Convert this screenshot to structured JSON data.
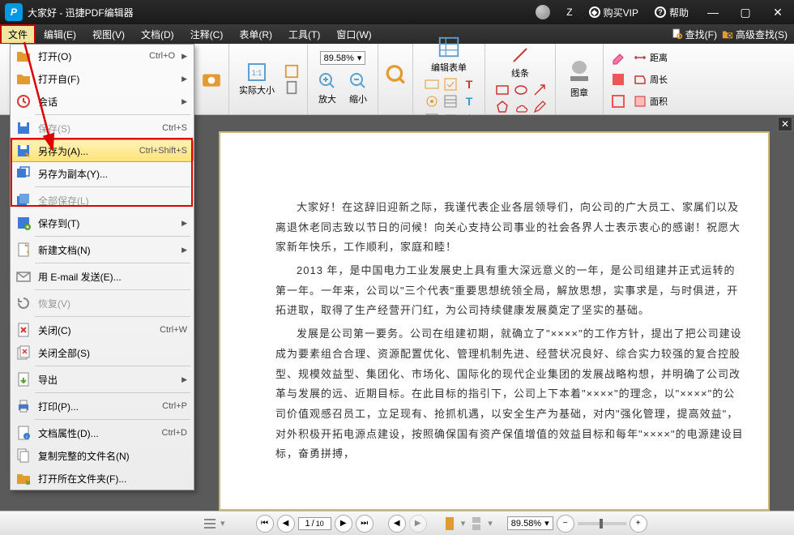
{
  "title": "大家好 - 迅捷PDF编辑器",
  "titlebar": {
    "z": "Z",
    "vip": "购买VIP",
    "help": "帮助"
  },
  "menubar": {
    "items": [
      "文件",
      "编辑(E)",
      "视图(V)",
      "文档(D)",
      "注释(C)",
      "表单(R)",
      "工具(T)",
      "窗口(W)"
    ],
    "find": "查找(F)",
    "advfind": "高级查找(S)"
  },
  "toolbar": {
    "actualsize": "实际大小",
    "zoomin": "放大",
    "zoomout": "缩小",
    "zoom_val": "89.58%",
    "editform": "编辑表单",
    "line": "线条",
    "image": "图章",
    "distance": "距离",
    "perimeter": "周长",
    "area": "面积"
  },
  "dropdown": {
    "items": [
      {
        "label": "打开(O)",
        "shortcut": "Ctrl+O",
        "arrow": true,
        "icon": "folder"
      },
      {
        "label": "打开自(F)",
        "shortcut": "",
        "arrow": true,
        "icon": "folder"
      },
      {
        "label": "会话",
        "shortcut": "",
        "arrow": true,
        "icon": "session"
      },
      {
        "sep": true
      },
      {
        "label": "保存(S)",
        "shortcut": "Ctrl+S",
        "arrow": false,
        "icon": "save",
        "disabled": true
      },
      {
        "label": "另存为(A)...",
        "shortcut": "Ctrl+Shift+S",
        "arrow": false,
        "icon": "saveas",
        "hover": true
      },
      {
        "label": "另存为副本(Y)...",
        "shortcut": "",
        "arrow": false,
        "icon": "savecopy"
      },
      {
        "sep": true
      },
      {
        "label": "全部保存(L)",
        "shortcut": "",
        "arrow": false,
        "icon": "saveall",
        "disabled": true
      },
      {
        "label": "保存到(T)",
        "shortcut": "",
        "arrow": true,
        "icon": "saveto"
      },
      {
        "sep": true
      },
      {
        "label": "新建文档(N)",
        "shortcut": "",
        "arrow": true,
        "icon": "newdoc"
      },
      {
        "sep": true
      },
      {
        "label": "用 E-mail 发送(E)...",
        "shortcut": "",
        "arrow": false,
        "icon": "email"
      },
      {
        "sep": true
      },
      {
        "label": "恢复(V)",
        "shortcut": "",
        "arrow": false,
        "icon": "restore",
        "disabled": true
      },
      {
        "sep": true
      },
      {
        "label": "关闭(C)",
        "shortcut": "Ctrl+W",
        "arrow": false,
        "icon": "close"
      },
      {
        "label": "关闭全部(S)",
        "shortcut": "",
        "arrow": false,
        "icon": "closeall"
      },
      {
        "sep": true
      },
      {
        "label": "导出",
        "shortcut": "",
        "arrow": true,
        "icon": "export"
      },
      {
        "sep": true
      },
      {
        "label": "打印(P)...",
        "shortcut": "Ctrl+P",
        "arrow": false,
        "icon": "print"
      },
      {
        "sep": true
      },
      {
        "label": "文档属性(D)...",
        "shortcut": "Ctrl+D",
        "arrow": false,
        "icon": "props"
      },
      {
        "label": "复制完整的文件名(N)",
        "shortcut": "",
        "arrow": false,
        "icon": "copyname"
      },
      {
        "label": "打开所在文件夹(F)...",
        "shortcut": "",
        "arrow": false,
        "icon": "openfolder"
      }
    ]
  },
  "document": {
    "p1": "大家好！在这辞旧迎新之际，我谨代表企业各层领导们，向公司的广大员工、家属们以及离退休老同志致以节日的问候！向关心支持公司事业的社会各界人士表示衷心的感谢！祝愿大家新年快乐，工作顺利，家庭和睦！",
    "p2": "2013 年，是中国电力工业发展史上具有重大深远意义的一年，是公司组建并正式运转的第一年。一年来，公司以\"三个代表\"重要思想统领全局，解放思想，实事求是，与时俱进，开拓进取，取得了生产经营开门红，为公司持续健康发展奠定了坚实的基础。",
    "p3": "发展是公司第一要务。公司在组建初期，就确立了\"××××\"的工作方针，提出了把公司建设成为要素组合合理、资源配置优化、管理机制先进、经营状况良好、综合实力较强的复合控股型、规模效益型、集团化、市场化、国际化的现代企业集团的发展战略构想，并明确了公司改革与发展的远、近期目标。在此目标的指引下，公司上下本着\"××××\"的理念，以\"××××\"的公司价值观感召员工，立足现有、抢抓机遇，以安全生产为基础，对内\"强化管理，提高效益\"，对外积极开拓电源点建设，按照确保国有资产保值增值的效益目标和每年\"××××\"的电源建设目标，奋勇拼搏，"
  },
  "status": {
    "page_cur": "1",
    "page_total": "10",
    "zoom": "89.58%"
  }
}
